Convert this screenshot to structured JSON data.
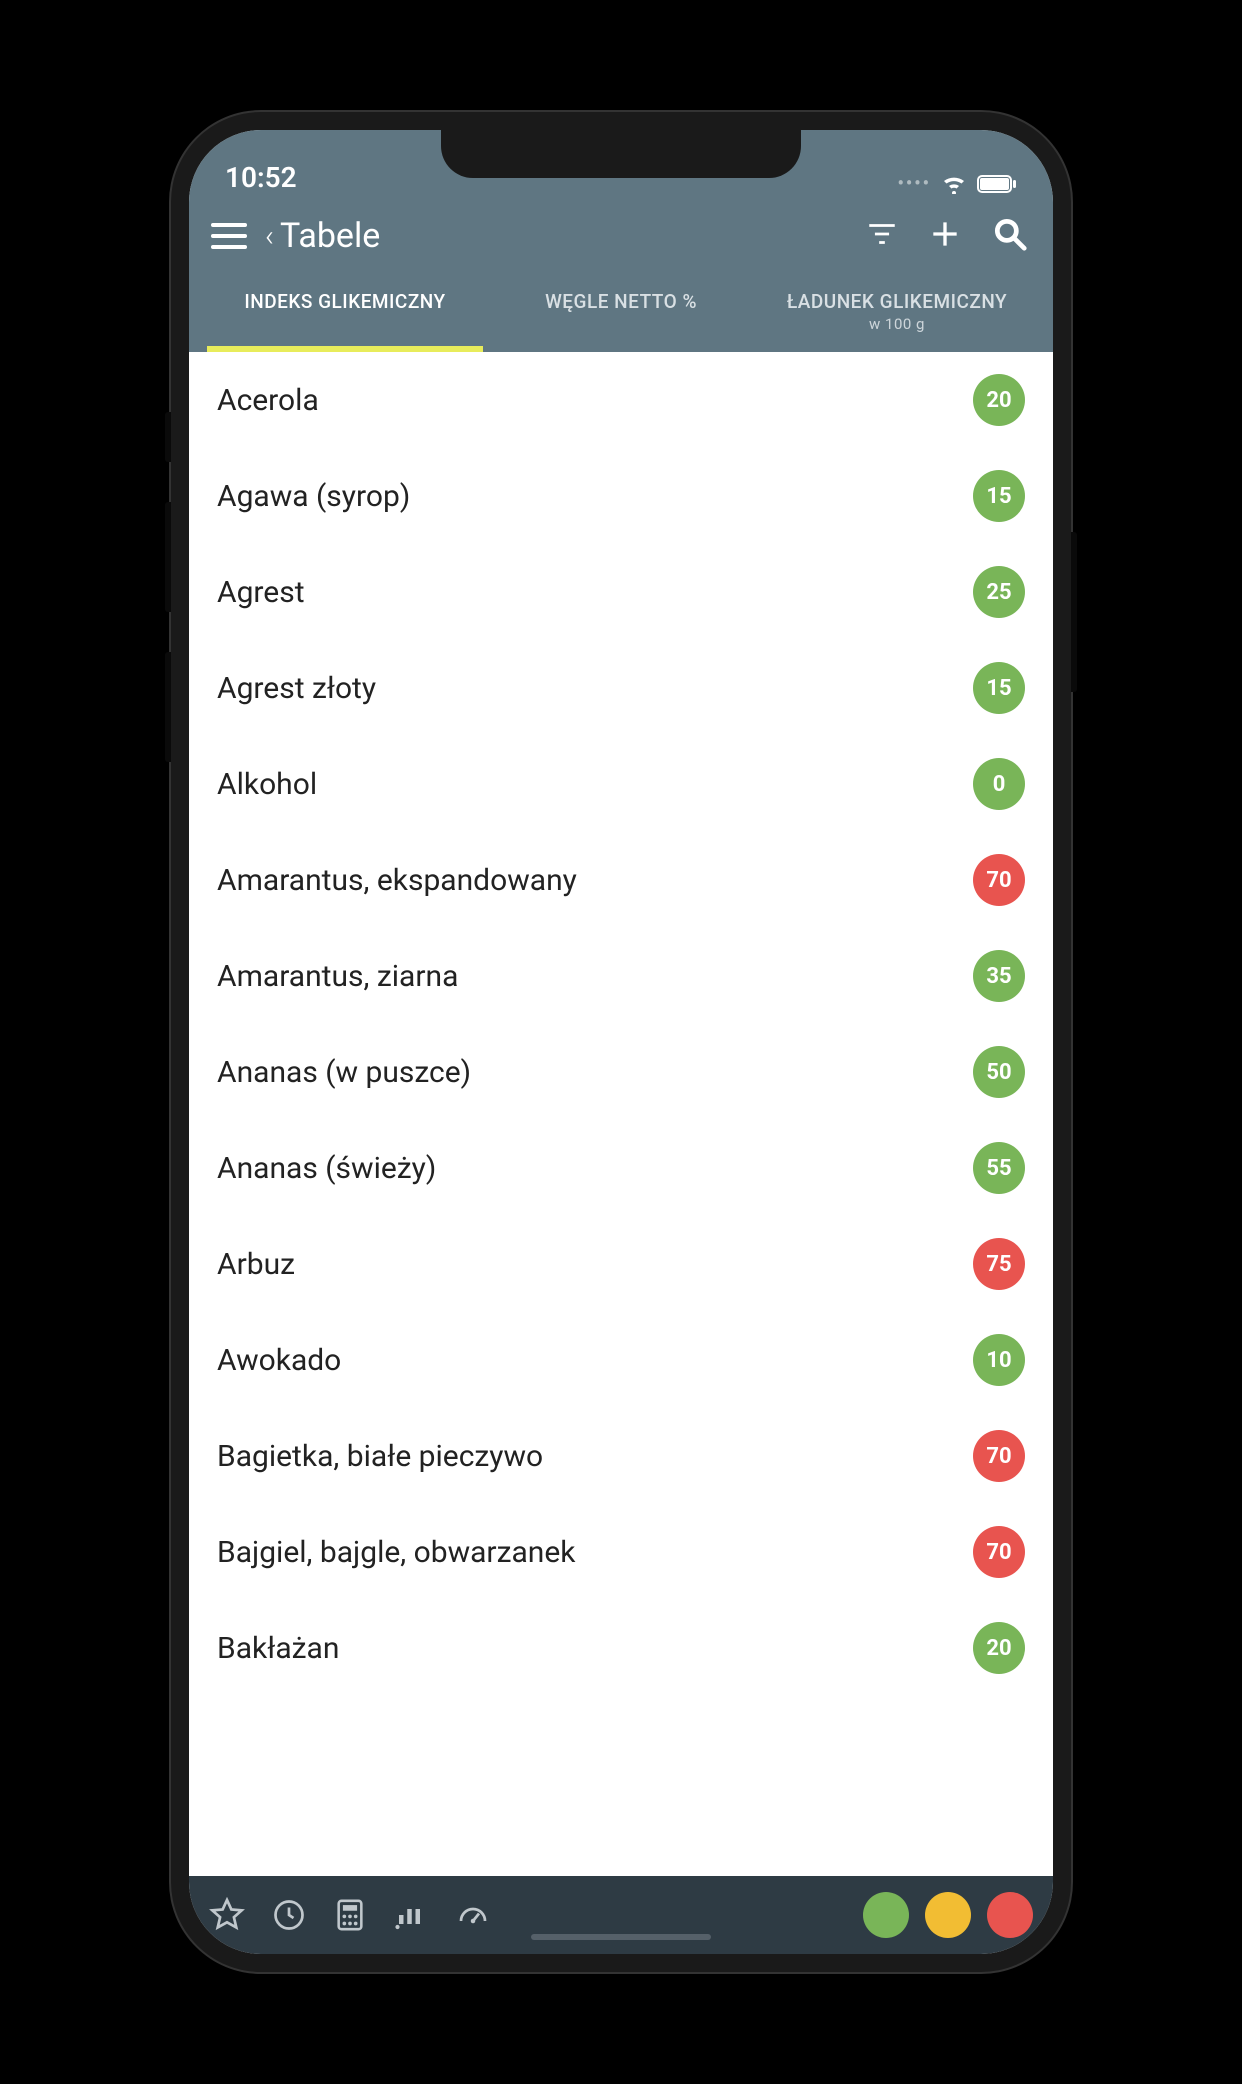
{
  "status": {
    "time": "10:52"
  },
  "header": {
    "title": "Tabele"
  },
  "tabs": [
    {
      "label": "INDEKS GLIKEMICZNY",
      "sub": "",
      "active": true
    },
    {
      "label": "WĘGLE NETTO %",
      "sub": "",
      "active": false
    },
    {
      "label": "ŁADUNEK GLIKEMICZNY",
      "sub": "w 100 g",
      "active": false
    }
  ],
  "items": [
    {
      "name": "Acerola",
      "value": "20",
      "level": "green"
    },
    {
      "name": "Agawa (syrop)",
      "value": "15",
      "level": "green"
    },
    {
      "name": "Agrest",
      "value": "25",
      "level": "green"
    },
    {
      "name": "Agrest złoty",
      "value": "15",
      "level": "green"
    },
    {
      "name": "Alkohol",
      "value": "0",
      "level": "green"
    },
    {
      "name": "Amarantus, ekspandowany",
      "value": "70",
      "level": "red"
    },
    {
      "name": "Amarantus, ziarna",
      "value": "35",
      "level": "green"
    },
    {
      "name": "Ananas (w puszce)",
      "value": "50",
      "level": "green"
    },
    {
      "name": "Ananas (świeży)",
      "value": "55",
      "level": "green"
    },
    {
      "name": "Arbuz",
      "value": "75",
      "level": "red"
    },
    {
      "name": "Awokado",
      "value": "10",
      "level": "green"
    },
    {
      "name": "Bagietka, białe pieczywo",
      "value": "70",
      "level": "red"
    },
    {
      "name": "Bajgiel, bajgle, obwarzanek",
      "value": "70",
      "level": "red"
    },
    {
      "name": "Bakłażan",
      "value": "20",
      "level": "green"
    }
  ],
  "colors": {
    "green": "#79b558",
    "yellow": "#f2bd33",
    "red": "#e8544f",
    "header": "#5f7682",
    "accent": "#e8ec5b"
  }
}
